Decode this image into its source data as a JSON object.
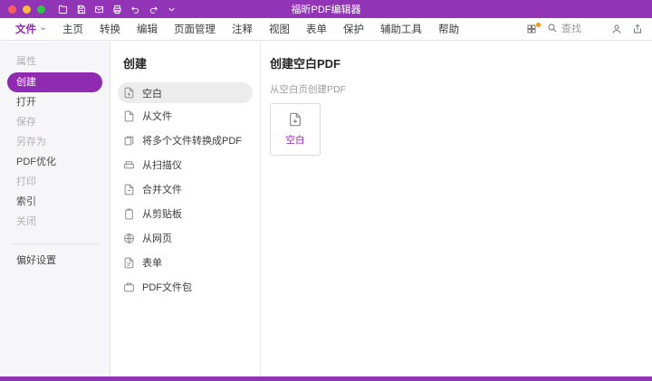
{
  "colors": {
    "accent": "#8e2bb0",
    "titlebar": "#9134b6",
    "notification_dot": "#ff9500"
  },
  "titlebar": {
    "title": "福昕PDF编辑器"
  },
  "menubar": {
    "items": [
      {
        "label": "文件"
      },
      {
        "label": "主页"
      },
      {
        "label": "转换"
      },
      {
        "label": "编辑"
      },
      {
        "label": "页面管理"
      },
      {
        "label": "注释"
      },
      {
        "label": "视图"
      },
      {
        "label": "表单"
      },
      {
        "label": "保护"
      },
      {
        "label": "辅助工具"
      },
      {
        "label": "帮助"
      }
    ],
    "search": {
      "placeholder": "查找"
    }
  },
  "sidebar": {
    "items": [
      {
        "label": "属性",
        "state": "disabled"
      },
      {
        "label": "创建",
        "state": "selected"
      },
      {
        "label": "打开",
        "state": "normal"
      },
      {
        "label": "保存",
        "state": "disabled"
      },
      {
        "label": "另存为",
        "state": "disabled"
      },
      {
        "label": "PDF优化",
        "state": "normal"
      },
      {
        "label": "打印",
        "state": "disabled"
      },
      {
        "label": "索引",
        "state": "normal"
      },
      {
        "label": "关闭",
        "state": "disabled"
      }
    ],
    "footer_item": "偏好设置"
  },
  "create_panel": {
    "title": "创建",
    "items": [
      {
        "label": "空白",
        "selected": true
      },
      {
        "label": "从文件"
      },
      {
        "label": "将多个文件转换成PDF"
      },
      {
        "label": "从扫描仪"
      },
      {
        "label": "合并文件"
      },
      {
        "label": "从剪贴板"
      },
      {
        "label": "从网页"
      },
      {
        "label": "表单"
      },
      {
        "label": "PDF文件包"
      }
    ]
  },
  "detail_panel": {
    "title": "创建空白PDF",
    "subtitle": "从空白页创建PDF",
    "card_label": "空白"
  }
}
